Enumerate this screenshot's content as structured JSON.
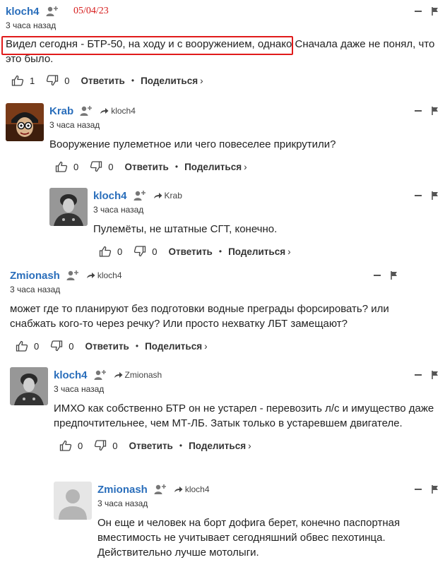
{
  "annotation": {
    "date": "05/04/23"
  },
  "labels": {
    "reply": "Ответить",
    "share": "Поделиться",
    "share_chevron": "›",
    "separator": "•"
  },
  "comments": [
    {
      "author": "kloch4",
      "reply_to": "",
      "time": "3 часа назад",
      "text_highlighted": "Видел сегодня - БТР-50, на ходу и с вооружением, однако",
      "text": "Сначала даже не понял, что это было.",
      "likes": "1",
      "dislikes": "0",
      "avatar": "none"
    },
    {
      "author": "Krab",
      "reply_to": "kloch4",
      "time": "3 часа назад",
      "text": "Вооружение пулеметное или чего повеселее прикрутили?",
      "likes": "0",
      "dislikes": "0",
      "avatar": "cartoon-character-with-helmet"
    },
    {
      "author": "kloch4",
      "reply_to": "Krab",
      "time": "3 часа назад",
      "text": "Пулемёты, не штатные СГТ, конечно.",
      "likes": "0",
      "dislikes": "0",
      "avatar": "soldier-photo"
    },
    {
      "author": "Zmionash",
      "reply_to": "kloch4",
      "time": "3 часа назад",
      "text": "может где то планируют без подготовки водные преграды форсировать? или снабжать кого-то через речку? Или просто нехватку ЛБТ замещают?",
      "likes": "0",
      "dislikes": "0",
      "avatar": "none"
    },
    {
      "author": "kloch4",
      "reply_to": "Zmionash",
      "time": "3 часа назад",
      "text": "ИМХО как собственно БТР он не устарел - перевозить л/с и имущество даже предпочтительнее, чем МТ-ЛБ. Затык только в устаревшем двигателе.",
      "likes": "0",
      "dislikes": "0",
      "avatar": "soldier-photo"
    },
    {
      "author": "Zmionash",
      "reply_to": "kloch4",
      "time": "3 часа назад",
      "text": "Он еще и человек на борт дофига берет, конечно паспортная вместимость не учитывает сегодняшний обвес пехотинца. Действительно лучше мотолыги.",
      "likes": "",
      "dislikes": "",
      "avatar": "default-user-silhouette"
    }
  ],
  "colors": {
    "author": "#2a6ebb",
    "highlight": "#e01a1a",
    "date": "#d61a1a"
  }
}
